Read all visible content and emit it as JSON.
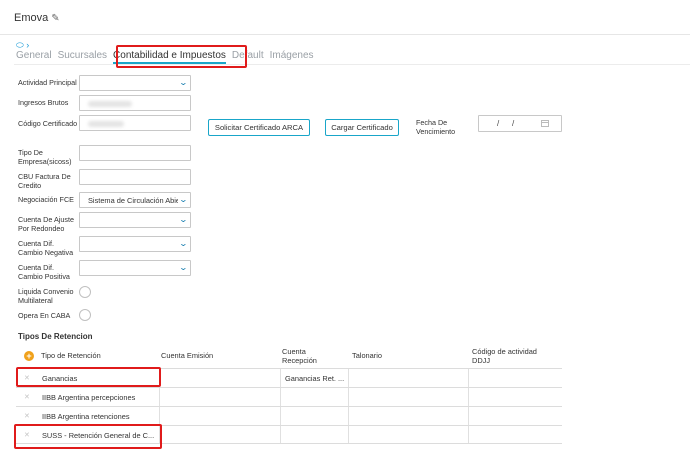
{
  "header": {
    "title": "Emova"
  },
  "tabs": [
    {
      "label": "General"
    },
    {
      "label": "Sucursales"
    },
    {
      "label": "Contabilidad e Impuestos"
    },
    {
      "label": "Default"
    },
    {
      "label": "Imágenes"
    }
  ],
  "form": {
    "actividad_principal": {
      "label": "Actividad Principal",
      "value": ""
    },
    "ingresos_brutos": {
      "label": "Ingresos Brutos"
    },
    "codigo_certificado": {
      "label": "Código Certificado"
    },
    "solicitar_btn": "Solicitar Certificado ARCA",
    "cargar_btn": "Cargar Certificado",
    "fecha_vencimiento": {
      "label": "Fecha De Vencimiento",
      "sep1": "/",
      "sep2": "/"
    },
    "tipo_empresa": {
      "label": "Tipo De Empresa(sicoss)",
      "value": ""
    },
    "cbu_factura": {
      "label": "CBU Factura De Credito",
      "value": ""
    },
    "negociacion_fce": {
      "label": "Negociación FCE",
      "value": "Sistema de Circulación Abierta"
    },
    "cuenta_ajuste": {
      "label": "Cuenta De Ajuste Por Redondeo",
      "value": ""
    },
    "cuenta_dif_neg": {
      "label": "Cuenta Dif. Cambio Negativa",
      "value": ""
    },
    "cuenta_dif_pos": {
      "label": "Cuenta Dif. Cambio Positiva",
      "value": ""
    },
    "liquida_convenio": {
      "label": "Liquida Convenio Multilateral"
    },
    "opera_caba": {
      "label": "Opera En CABA"
    }
  },
  "retenciones": {
    "title": "Tipos De Retencion",
    "headers": {
      "tipo": "Tipo de Retención",
      "cuenta_emision": "Cuenta Emisión",
      "cuenta_recepcion": "Cuenta Recepción",
      "talonario": "Talonario",
      "codigo": "Código de actividad DDJJ"
    },
    "rows": [
      {
        "tipo": "Ganancias",
        "cuenta_recepcion": "Ganancias Ret. ..."
      },
      {
        "tipo": "IIBB Argentina percepciones",
        "cuenta_recepcion": ""
      },
      {
        "tipo": "IIBB Argentina retenciones",
        "cuenta_recepcion": ""
      },
      {
        "tipo": "SUSS - Retención General de C...",
        "cuenta_recepcion": ""
      }
    ]
  },
  "colors": {
    "accent": "#19a6c9",
    "highlight": "#e01b1b",
    "add": "#f0a11b"
  }
}
